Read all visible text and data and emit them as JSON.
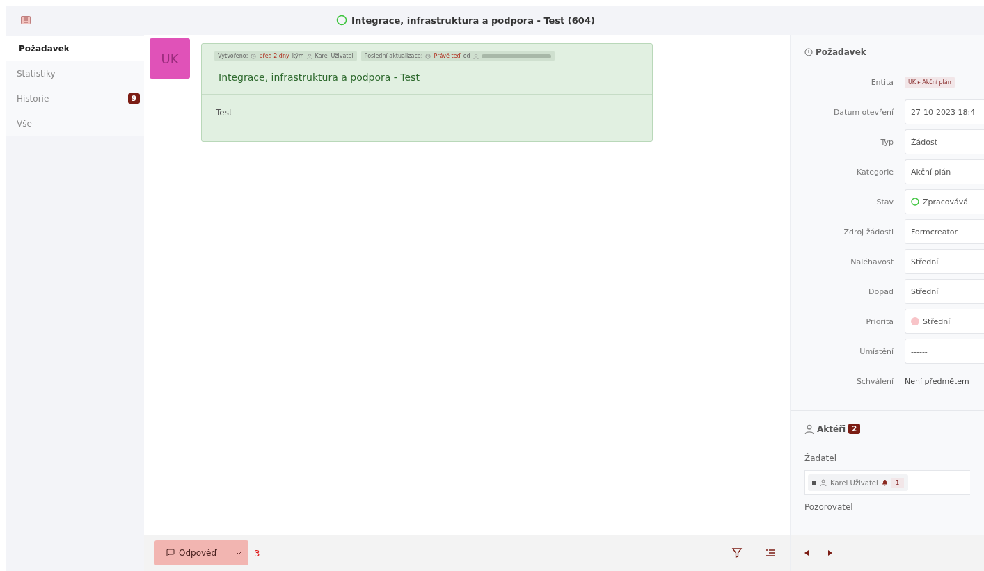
{
  "header": {
    "title": "Integrace, infrastruktura a podpora - Test (604)"
  },
  "tabs": [
    {
      "label": "Požadavek",
      "selected": true
    },
    {
      "label": "Statistiky",
      "selected": false
    },
    {
      "label": "Historie",
      "selected": false,
      "badge": "9"
    },
    {
      "label": "Vše",
      "selected": false
    }
  ],
  "item": {
    "avatar": "UK",
    "meta": [
      {
        "label": "Vytvořeno:",
        "time": "před 2 dny",
        "suffix": "kým",
        "user": "Karel Uživatel",
        "user_redacted": false
      },
      {
        "label": "Poslední aktualizace:",
        "time": "Právě teď",
        "suffix": "od",
        "user_redacted": true
      }
    ],
    "title": "Integrace, infrastruktura a podpora - Test",
    "content": "Test"
  },
  "footer": {
    "reply_button": "Odpověď",
    "count": "3"
  },
  "details": {
    "title": "Požadavek",
    "fields": [
      {
        "kind": "tag",
        "label": "Entita",
        "value": "UK ▸ Akční plán"
      },
      {
        "kind": "input",
        "label": "Datum otevření",
        "value": "27-10-2023 18:4"
      },
      {
        "kind": "input",
        "label": "Typ",
        "value": "Žádost"
      },
      {
        "kind": "input",
        "label": "Kategorie",
        "value": "Akční plán"
      },
      {
        "kind": "status",
        "label": "Stav",
        "value": "Zpracovává"
      },
      {
        "kind": "input",
        "label": "Zdroj žádosti",
        "value": "Formcreator"
      },
      {
        "kind": "input",
        "label": "Naléhavost",
        "value": "Střední"
      },
      {
        "kind": "input",
        "label": "Dopad",
        "value": "Střední"
      },
      {
        "kind": "dot",
        "label": "Priorita",
        "value": "Střední",
        "color": "#f8c4c8"
      },
      {
        "kind": "input",
        "label": "Umístění",
        "value": "------"
      },
      {
        "kind": "text",
        "label": "Schválení",
        "value": "Není předmětem"
      }
    ]
  },
  "actors": {
    "title": "Aktéři",
    "count": "2",
    "groups": [
      {
        "label": "Žadatel",
        "people": [
          {
            "name": "Karel Uživatel",
            "notifications": "1"
          }
        ]
      },
      {
        "label": "Pozorovatel"
      }
    ]
  }
}
